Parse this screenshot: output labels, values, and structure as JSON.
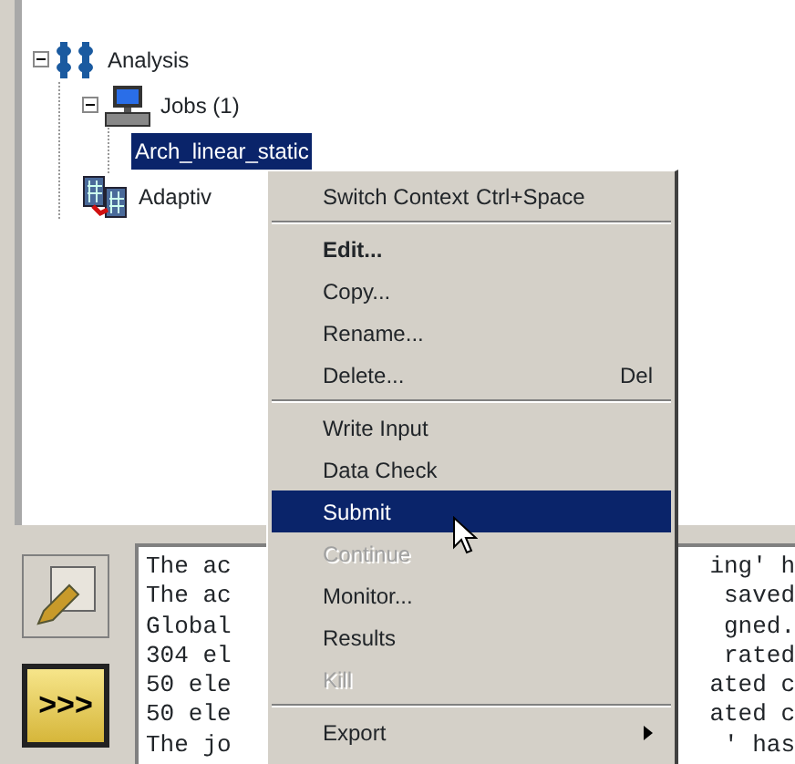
{
  "tree": [
    {
      "label": "Analysis",
      "kind": "steps",
      "expanded": true,
      "selected": false,
      "children": [
        {
          "label": "Jobs (1)",
          "kind": "computer",
          "expanded": true,
          "selected": false,
          "children": [
            {
              "label": "Arch_linear_static",
              "selected": true
            }
          ]
        },
        {
          "label": "Adaptiv",
          "kind": "grid",
          "selected": false
        }
      ]
    }
  ],
  "toolbar": [
    {
      "kind": "pencil",
      "selected": false
    },
    {
      "kind": "arrows",
      "label": ">>>",
      "selected": true
    }
  ],
  "messages": [
    {
      "start": "The ac",
      "end": "ing' h"
    },
    {
      "start": "The ac",
      "end": "saved"
    },
    {
      "start": "Global",
      "end": "gned."
    },
    {
      "start": "304 el",
      "end": "rated"
    },
    {
      "start": "50 ele",
      "end": "ated c"
    },
    {
      "start": "50 ele",
      "end": "ated c"
    },
    {
      "start": "The jo",
      "end": "' has"
    }
  ],
  "context_menu": [
    {
      "kind": "item",
      "label": "Switch Context",
      "shortcut": "Ctrl+Space",
      "bold": false,
      "disabled": false,
      "selected": false,
      "submenu": false
    },
    {
      "kind": "separator"
    },
    {
      "kind": "item",
      "label": "Edit...",
      "bold": true,
      "disabled": false,
      "selected": false,
      "submenu": false
    },
    {
      "kind": "item",
      "label": "Copy...",
      "bold": false,
      "disabled": false,
      "selected": false,
      "submenu": false
    },
    {
      "kind": "item",
      "label": "Rename...",
      "bold": false,
      "disabled": false,
      "selected": false,
      "submenu": false
    },
    {
      "kind": "item",
      "label": "Delete...",
      "shortcut": "Del",
      "bold": false,
      "disabled": false,
      "selected": false,
      "submenu": false
    },
    {
      "kind": "separator"
    },
    {
      "kind": "item",
      "label": "Write Input",
      "bold": false,
      "disabled": false,
      "selected": false,
      "submenu": false
    },
    {
      "kind": "item",
      "label": "Data Check",
      "bold": false,
      "disabled": false,
      "selected": false,
      "submenu": false
    },
    {
      "kind": "item",
      "label": "Submit",
      "bold": false,
      "disabled": false,
      "selected": true,
      "submenu": false
    },
    {
      "kind": "item",
      "label": "Continue",
      "bold": false,
      "disabled": true,
      "selected": false,
      "submenu": false
    },
    {
      "kind": "item",
      "label": "Monitor...",
      "bold": false,
      "disabled": false,
      "selected": false,
      "submenu": false
    },
    {
      "kind": "item",
      "label": "Results",
      "bold": false,
      "disabled": false,
      "selected": false,
      "submenu": false
    },
    {
      "kind": "item",
      "label": "Kill",
      "bold": false,
      "disabled": true,
      "selected": false,
      "submenu": false
    },
    {
      "kind": "separator"
    },
    {
      "kind": "item",
      "label": "Export",
      "bold": false,
      "disabled": false,
      "selected": false,
      "submenu": true
    }
  ]
}
